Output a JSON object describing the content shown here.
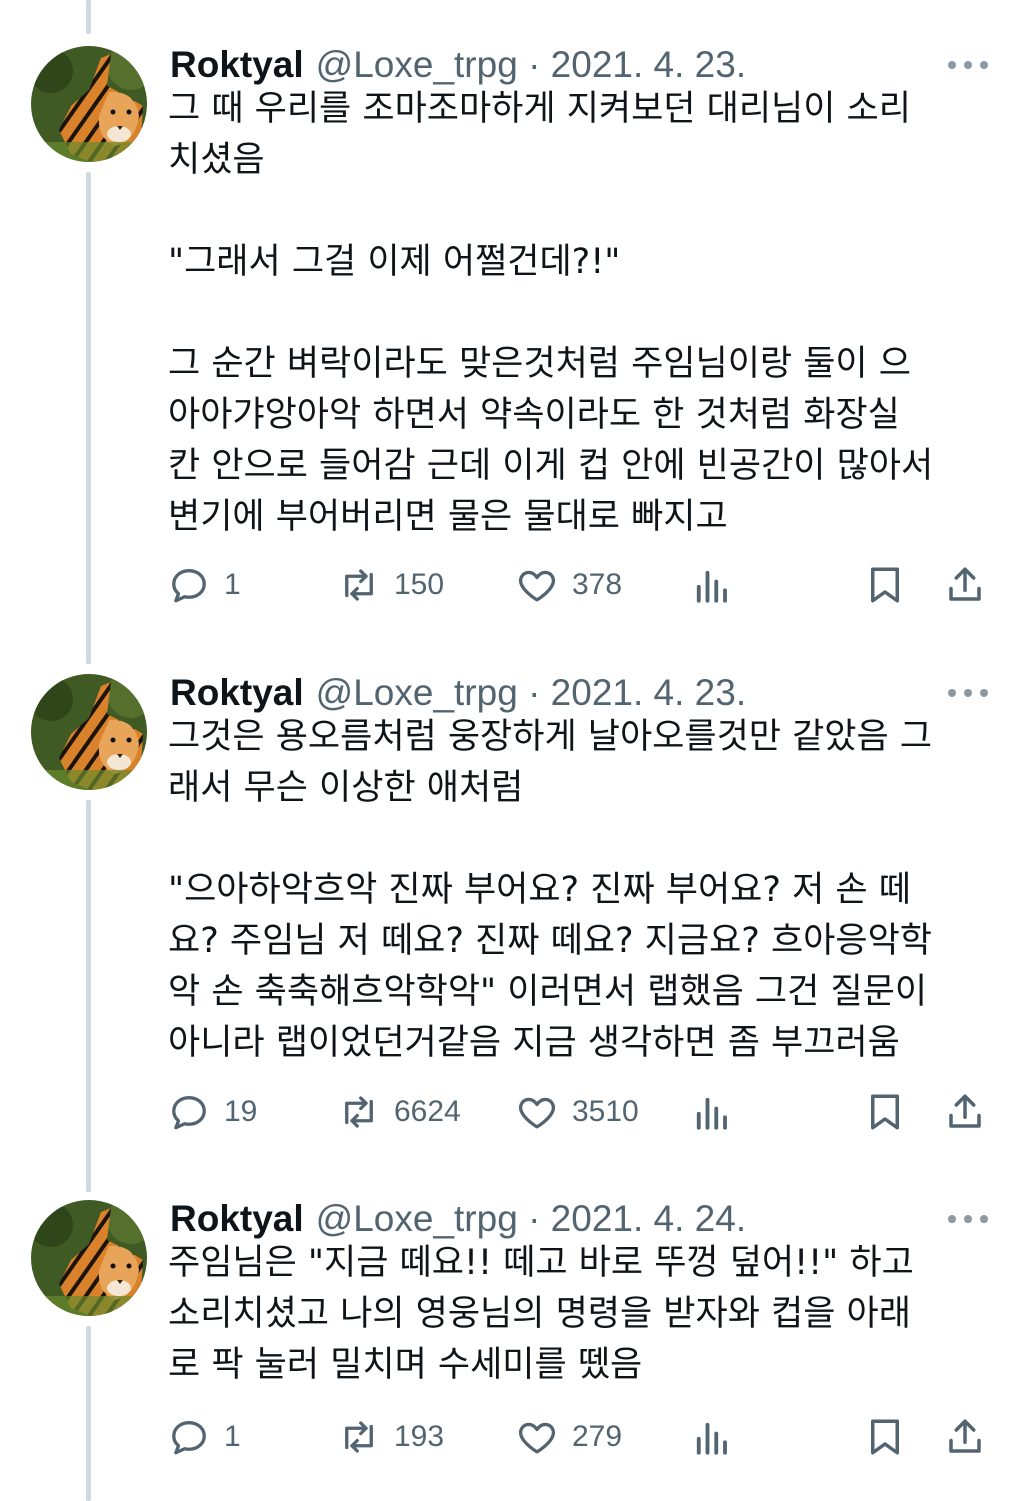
{
  "tweets": [
    {
      "name": "Roktyal",
      "meta": "@Loxe_trpg · 2021. 4. 23.",
      "text": "그 때 우리를 조마조마하게 지켜보던 대리님이 소리\n치셨음\n\n\"그래서 그걸 이제 어쩔건데?!\"\n\n그 순간 벼락이라도 맞은것처럼 주임님이랑 둘이 으\n아아갸앙아악 하면서 약속이라도 한 것처럼 화장실\n칸 안으로 들어감 근데 이게 컵 안에 빈공간이 많아서\n변기에 부어버리면 물은 물대로 빠지고",
      "replies": "1",
      "retweets": "150",
      "likes": "378"
    },
    {
      "name": "Roktyal",
      "meta": "@Loxe_trpg · 2021. 4. 23.",
      "text": "그것은 용오름처럼 웅장하게 날아오를것만 같았음 그\n래서 무슨 이상한 애처럼\n\n\"으아하악흐악 진짜 부어요? 진짜 부어요? 저 손 떼\n요? 주임님 저 떼요? 진짜 떼요? 지금요? 흐아응악학\n악 손 축축해흐악학악\" 이러면서 랩했음 그건 질문이\n아니라 랩이었던거같음 지금 생각하면 좀 부끄러움",
      "replies": "19",
      "retweets": "6624",
      "likes": "3510"
    },
    {
      "name": "Roktyal",
      "meta": "@Loxe_trpg · 2021. 4. 24.",
      "text": "주임님은 \"지금 떼요!! 떼고 바로 뚜껑 덮어!!\" 하고\n소리치셨고 나의 영웅님의 명령을 받자와 컵을 아래\n로 팍 눌러 밀치며 수세미를 뗐음",
      "replies": "1",
      "retweets": "193",
      "likes": "279"
    }
  ],
  "icons": {
    "reply": "speech-bubble-icon",
    "retweet": "retweet-icon",
    "like": "heart-icon",
    "views": "bar-chart-icon",
    "bookmark": "bookmark-icon",
    "share": "share-upload-icon",
    "more": "more-dots-icon"
  },
  "colors": {
    "text": "#0f1419",
    "secondary": "#536471",
    "thread_line": "#cfd9de"
  }
}
